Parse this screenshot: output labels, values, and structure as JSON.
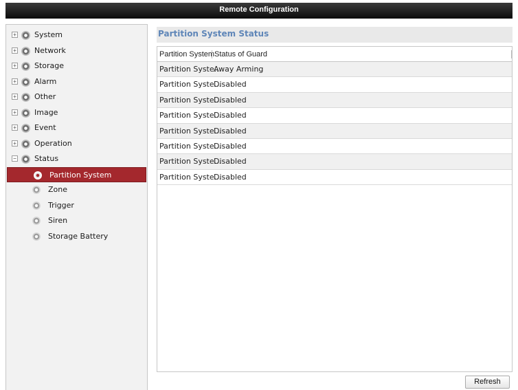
{
  "window": {
    "title": "Remote Configuration"
  },
  "sidebar": {
    "items": [
      {
        "label": "System",
        "expander": "+",
        "icon": "gear-icon"
      },
      {
        "label": "Network",
        "expander": "+",
        "icon": "gear-icon"
      },
      {
        "label": "Storage",
        "expander": "+",
        "icon": "gear-icon"
      },
      {
        "label": "Alarm",
        "expander": "+",
        "icon": "gear-icon"
      },
      {
        "label": "Other",
        "expander": "+",
        "icon": "gear-icon"
      },
      {
        "label": "Image",
        "expander": "+",
        "icon": "gear-icon"
      },
      {
        "label": "Event",
        "expander": "+",
        "icon": "gear-icon"
      },
      {
        "label": "Operation",
        "expander": "+",
        "icon": "gear-icon"
      },
      {
        "label": "Status",
        "expander": "−",
        "icon": "gear-icon"
      }
    ],
    "status_children": [
      {
        "label": "Partition System",
        "selected": true
      },
      {
        "label": "Zone"
      },
      {
        "label": "Trigger"
      },
      {
        "label": "Siren"
      },
      {
        "label": "Storage Battery"
      }
    ],
    "selected_color": "#a4282d"
  },
  "main": {
    "title": "Partition System Status",
    "title_color": "#5f86b8",
    "table": {
      "columns": [
        "Partition System",
        "Status of Guard"
      ],
      "rows": [
        [
          "Partition Syste...",
          "Away Arming"
        ],
        [
          "Partition Syste...",
          "Disabled"
        ],
        [
          "Partition Syste...",
          "Disabled"
        ],
        [
          "Partition Syste...",
          "Disabled"
        ],
        [
          "Partition Syste...",
          "Disabled"
        ],
        [
          "Partition Syste...",
          "Disabled"
        ],
        [
          "Partition Syste...",
          "Disabled"
        ],
        [
          "Partition Syste...",
          "Disabled"
        ]
      ]
    },
    "refresh_label": "Refresh"
  }
}
